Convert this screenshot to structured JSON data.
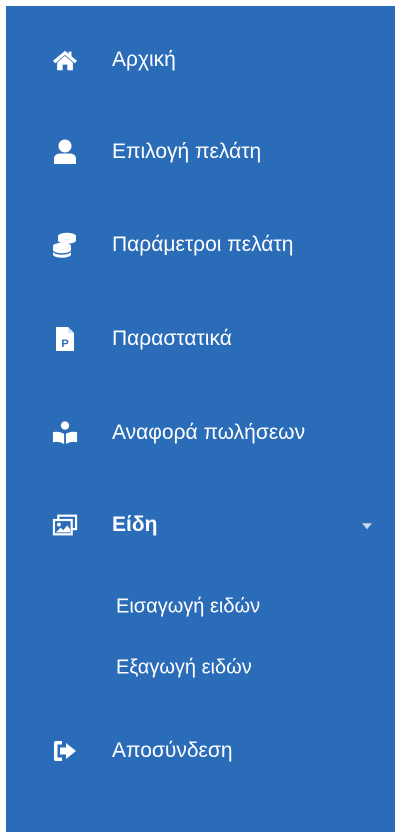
{
  "sidebar": {
    "items": [
      {
        "label": "Αρχική",
        "icon": "home-icon"
      },
      {
        "label": "Επιλογή πελάτη",
        "icon": "user-icon"
      },
      {
        "label": "Παράμετροι πελάτη",
        "icon": "coins-icon"
      },
      {
        "label": "Παραστατικά",
        "icon": "document-icon"
      },
      {
        "label": "Αναφορά πωλήσεων",
        "icon": "reader-icon"
      },
      {
        "label": "Είδη",
        "icon": "images-icon",
        "expanded": true,
        "children": [
          {
            "label": "Εισαγωγή ειδών"
          },
          {
            "label": "Εξαγωγή ειδών"
          }
        ]
      },
      {
        "label": "Αποσύνδεση",
        "icon": "sign-out-icon"
      }
    ]
  },
  "colors": {
    "sidebar_background": "#2b6cb9",
    "text": "#ffffff",
    "caret": "#c9d9ee"
  }
}
